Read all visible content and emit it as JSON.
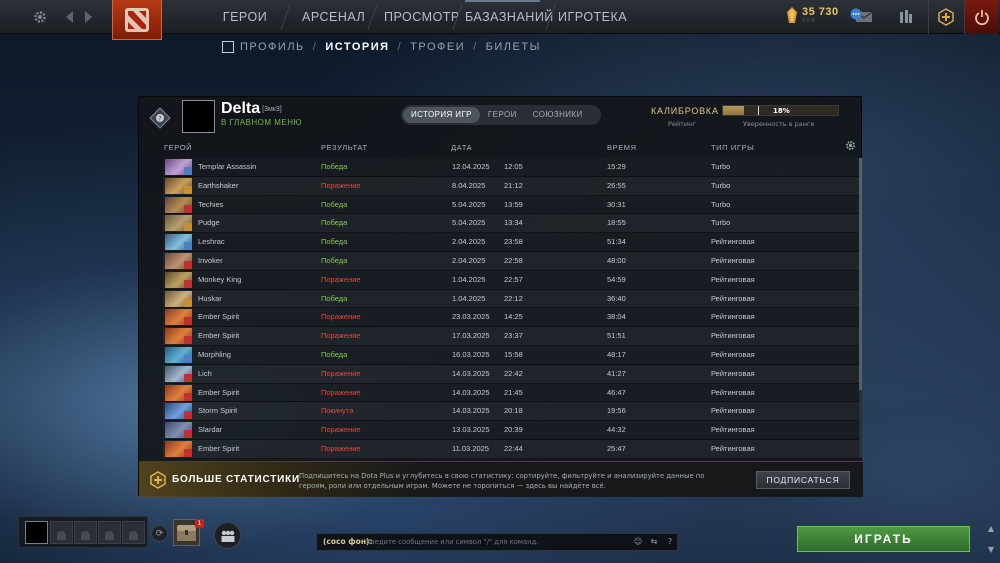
{
  "nav": {
    "items": [
      "ГЕРОИ",
      "АРСЕНАЛ",
      "ПРОСМОТР",
      "БАЗАЗНАНИЙ",
      "ИГРОТЕКА"
    ],
    "gold": "35 730",
    "gold_sub": "0 0 0"
  },
  "subnav": {
    "items": [
      "ПРОФИЛЬ",
      "ИСТОРИЯ",
      "ТРОФЕИ",
      "БИЛЕТЫ"
    ],
    "active": "ИСТОРИЯ"
  },
  "profile": {
    "name": "Delta",
    "tag": "[3мк3]",
    "status": "В ГЛАВНОМ МЕНЮ",
    "tabs": [
      "ИСТОРИЯ ИГР",
      "ГЕРОИ",
      "СОЮЗНИКИ"
    ],
    "calibration_label": "КАЛИБРОВКА",
    "rating_label": "Рейтинг",
    "confidence_label": "Уверенность в ранге",
    "confidence_pct": "18%",
    "confidence_value": 0.18
  },
  "table": {
    "headers": {
      "hero": "ГЕРОЙ",
      "result": "РЕЗУЛЬТАТ",
      "date": "ДАТА",
      "duration": "ВРЕМЯ",
      "type": "ТИП ИГРЫ"
    },
    "rows": [
      {
        "hero": "Templar Assassin",
        "result": "Победа",
        "status": "win",
        "date": "12.04.2025",
        "time": "12:05",
        "duration": "15:29",
        "type": "Turbo",
        "c1": "#6b4a7a",
        "c2": "#c0a0d8",
        "role": "#4f7fc0"
      },
      {
        "hero": "Earthshaker",
        "result": "Поражение",
        "status": "loss",
        "date": "8.04.2025",
        "time": "21:12",
        "duration": "26:55",
        "type": "Turbo",
        "c1": "#6a4a2a",
        "c2": "#c8a060",
        "role": "#c89030"
      },
      {
        "hero": "Techies",
        "result": "Победа",
        "status": "win",
        "date": "5.04.2025",
        "time": "13:59",
        "duration": "30:31",
        "type": "Turbo",
        "c1": "#5a4a3a",
        "c2": "#b88a50",
        "role": "#c03030"
      },
      {
        "hero": "Pudge",
        "result": "Победа",
        "status": "win",
        "date": "5.04.2025",
        "time": "13:34",
        "duration": "18:55",
        "type": "Turbo",
        "c1": "#6a5a3a",
        "c2": "#b8a070",
        "role": "#c89030"
      },
      {
        "hero": "Leshrac",
        "result": "Победа",
        "status": "win",
        "date": "2.04.2025",
        "time": "23:58",
        "duration": "51:34",
        "type": "Рейтинговая",
        "c1": "#3a5a7a",
        "c2": "#80c0e0",
        "role": "#4f7fc0"
      },
      {
        "hero": "Invoker",
        "result": "Победа",
        "status": "win",
        "date": "2.04.2025",
        "time": "22:58",
        "duration": "48:00",
        "type": "Рейтинговая",
        "c1": "#6a4a3a",
        "c2": "#c09070",
        "role": "#c03030"
      },
      {
        "hero": "Monkey King",
        "result": "Поражение",
        "status": "loss",
        "date": "1.04.2025",
        "time": "22:57",
        "duration": "54:59",
        "type": "Рейтинговая",
        "c1": "#5a4a2a",
        "c2": "#c0a060",
        "role": "#c03030"
      },
      {
        "hero": "Huskar",
        "result": "Победа",
        "status": "win",
        "date": "1.04.2025",
        "time": "22:12",
        "duration": "36:40",
        "type": "Рейтинговая",
        "c1": "#6a5a3a",
        "c2": "#d0b080",
        "role": "#c89030"
      },
      {
        "hero": "Ember Spirit",
        "result": "Поражение",
        "status": "loss",
        "date": "23.03.2025",
        "time": "14:25",
        "duration": "38:04",
        "type": "Рейтинговая",
        "c1": "#8a3a1a",
        "c2": "#e08040",
        "role": "#c03030"
      },
      {
        "hero": "Ember Spirit",
        "result": "Поражение",
        "status": "loss",
        "date": "17.03.2025",
        "time": "23:37",
        "duration": "51:51",
        "type": "Рейтинговая",
        "c1": "#8a3a1a",
        "c2": "#e08040",
        "role": "#c03030"
      },
      {
        "hero": "Morphling",
        "result": "Победа",
        "status": "win",
        "date": "16.03.2025",
        "time": "15:58",
        "duration": "48:17",
        "type": "Рейтинговая",
        "c1": "#2a5a7a",
        "c2": "#60b0d8",
        "role": "#4f7fc0"
      },
      {
        "hero": "Lich",
        "result": "Поражение",
        "status": "loss",
        "date": "14.03.2025",
        "time": "22:42",
        "duration": "41:27",
        "type": "Рейтинговая",
        "c1": "#4a5a6a",
        "c2": "#a0b8d0",
        "role": "#c03030"
      },
      {
        "hero": "Ember Spirit",
        "result": "Поражение",
        "status": "loss",
        "date": "14.03.2025",
        "time": "21:45",
        "duration": "46:47",
        "type": "Рейтинговая",
        "c1": "#8a3a1a",
        "c2": "#e08040",
        "role": "#c03030"
      },
      {
        "hero": "Storm Spirit",
        "result": "Покинута",
        "status": "abandon",
        "date": "14.03.2025",
        "time": "20:18",
        "duration": "19:56",
        "type": "Рейтинговая",
        "c1": "#2a4a7a",
        "c2": "#70a0e0",
        "role": "#c03030"
      },
      {
        "hero": "Slardar",
        "result": "Поражение",
        "status": "loss",
        "date": "13.03.2025",
        "time": "20:39",
        "duration": "44:32",
        "type": "Рейтинговая",
        "c1": "#3a4a6a",
        "c2": "#8090b0",
        "role": "#c03030"
      },
      {
        "hero": "Ember Spirit",
        "result": "Поражение",
        "status": "loss",
        "date": "11.03.2025",
        "time": "22:44",
        "duration": "25:47",
        "type": "Рейтинговая",
        "c1": "#8a3a1a",
        "c2": "#e08040",
        "role": "#c03030"
      }
    ]
  },
  "promo": {
    "title": "БОЛЬШЕ СТАТИСТИКИ",
    "text": "Подпишитесь на Dota Plus и углубитесь в свою статистику: сортируйте, фильтруйте и анализируйте данные по героям, роли или отдельным играм. Можете не торопиться — здесь вы найдёте всё.",
    "button": "ПОДПИСАТЬСЯ"
  },
  "bottom": {
    "chat_channel": "(сосо фон):",
    "chat_placeholder": "Введите сообщение или символ \"/\" для команд.",
    "inventory_badge": "1",
    "play": "ИГРАТЬ"
  }
}
